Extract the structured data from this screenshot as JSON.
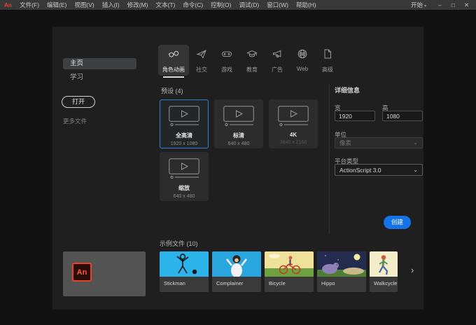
{
  "window": {
    "menu_logo": "An",
    "menu_items": [
      "文件(F)",
      "编辑(E)",
      "视图(V)",
      "插入(I)",
      "修改(M)",
      "文本(T)",
      "命令(C)",
      "控制(O)",
      "调试(D)",
      "窗口(W)",
      "帮助(H)"
    ],
    "start_button": "开始",
    "start_caret": "▾",
    "minimize_glyph": "–",
    "maximize_glyph": "□",
    "close_glyph": "✕"
  },
  "sidebar": {
    "items": [
      {
        "label": "主页",
        "selected": true
      },
      {
        "label": "学习",
        "selected": false
      }
    ],
    "open_button": "打开",
    "more_files": "更多文件"
  },
  "tabs": [
    {
      "label": "角色动画",
      "icon": "character-glasses-icon",
      "selected": true
    },
    {
      "label": "社交",
      "icon": "paper-plane-icon",
      "selected": false
    },
    {
      "label": "游戏",
      "icon": "gamepad-icon",
      "selected": false
    },
    {
      "label": "教育",
      "icon": "graduation-cap-icon",
      "selected": false
    },
    {
      "label": "广告",
      "icon": "megaphone-icon",
      "selected": false
    },
    {
      "label": "Web",
      "icon": "globe-icon",
      "selected": false
    },
    {
      "label": "高级",
      "icon": "document-icon",
      "selected": false
    }
  ],
  "presets": {
    "header": "预设 (4)",
    "cards": [
      {
        "title": "全高清",
        "resolution": "1920 x 1080",
        "selected": true
      },
      {
        "title": "标清",
        "resolution": "640 x 480",
        "selected": false
      },
      {
        "title": "4K",
        "resolution": "3840 x 2160",
        "selected": false
      },
      {
        "title": "缩放",
        "resolution": "640 x 480",
        "selected": false
      }
    ]
  },
  "details": {
    "header": "详细信息",
    "width_label": "宽",
    "width_value": "1920",
    "height_label": "高",
    "height_value": "1080",
    "units_label": "单位",
    "units_value": "像素",
    "platform_label": "平台类型",
    "platform_value": "ActionScript 3.0",
    "dropdown_glyph": "⌄",
    "create_button": "创建"
  },
  "samples": {
    "header": "示例文件 (10)",
    "cards": [
      {
        "name": "Stickman"
      },
      {
        "name": "Complainer"
      },
      {
        "name": "Bicycle"
      },
      {
        "name": "Hippo"
      },
      {
        "name": "Walkcycle"
      }
    ],
    "next_arrow": "›",
    "app_badge": "An"
  },
  "colors": {
    "accent_blue": "#1473e6",
    "selected_border": "#2f7fd6",
    "logo_red": "#e8432c",
    "menubar_bg": "#383838",
    "panel_bg": "#1f1f1f"
  }
}
